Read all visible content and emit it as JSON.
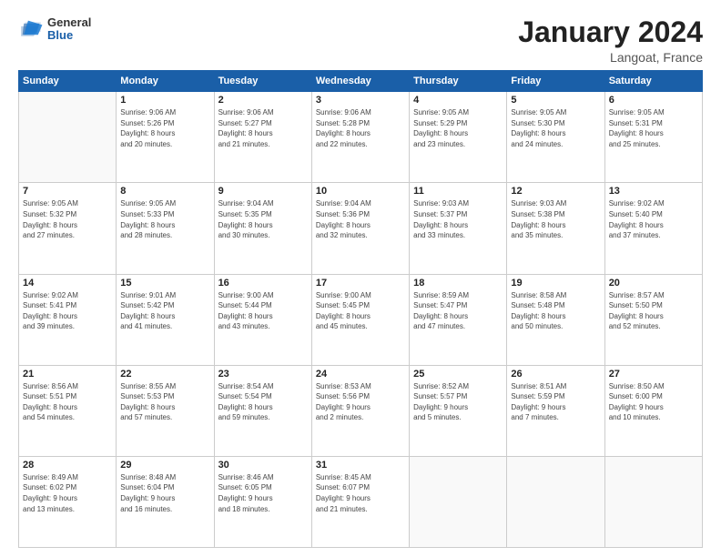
{
  "logo": {
    "general": "General",
    "blue": "Blue"
  },
  "header": {
    "month": "January 2024",
    "location": "Langoat, France"
  },
  "weekdays": [
    "Sunday",
    "Monday",
    "Tuesday",
    "Wednesday",
    "Thursday",
    "Friday",
    "Saturday"
  ],
  "weeks": [
    [
      {
        "day": "",
        "info": ""
      },
      {
        "day": "1",
        "info": "Sunrise: 9:06 AM\nSunset: 5:26 PM\nDaylight: 8 hours\nand 20 minutes."
      },
      {
        "day": "2",
        "info": "Sunrise: 9:06 AM\nSunset: 5:27 PM\nDaylight: 8 hours\nand 21 minutes."
      },
      {
        "day": "3",
        "info": "Sunrise: 9:06 AM\nSunset: 5:28 PM\nDaylight: 8 hours\nand 22 minutes."
      },
      {
        "day": "4",
        "info": "Sunrise: 9:05 AM\nSunset: 5:29 PM\nDaylight: 8 hours\nand 23 minutes."
      },
      {
        "day": "5",
        "info": "Sunrise: 9:05 AM\nSunset: 5:30 PM\nDaylight: 8 hours\nand 24 minutes."
      },
      {
        "day": "6",
        "info": "Sunrise: 9:05 AM\nSunset: 5:31 PM\nDaylight: 8 hours\nand 25 minutes."
      }
    ],
    [
      {
        "day": "7",
        "info": "Sunrise: 9:05 AM\nSunset: 5:32 PM\nDaylight: 8 hours\nand 27 minutes."
      },
      {
        "day": "8",
        "info": "Sunrise: 9:05 AM\nSunset: 5:33 PM\nDaylight: 8 hours\nand 28 minutes."
      },
      {
        "day": "9",
        "info": "Sunrise: 9:04 AM\nSunset: 5:35 PM\nDaylight: 8 hours\nand 30 minutes."
      },
      {
        "day": "10",
        "info": "Sunrise: 9:04 AM\nSunset: 5:36 PM\nDaylight: 8 hours\nand 32 minutes."
      },
      {
        "day": "11",
        "info": "Sunrise: 9:03 AM\nSunset: 5:37 PM\nDaylight: 8 hours\nand 33 minutes."
      },
      {
        "day": "12",
        "info": "Sunrise: 9:03 AM\nSunset: 5:38 PM\nDaylight: 8 hours\nand 35 minutes."
      },
      {
        "day": "13",
        "info": "Sunrise: 9:02 AM\nSunset: 5:40 PM\nDaylight: 8 hours\nand 37 minutes."
      }
    ],
    [
      {
        "day": "14",
        "info": "Sunrise: 9:02 AM\nSunset: 5:41 PM\nDaylight: 8 hours\nand 39 minutes."
      },
      {
        "day": "15",
        "info": "Sunrise: 9:01 AM\nSunset: 5:42 PM\nDaylight: 8 hours\nand 41 minutes."
      },
      {
        "day": "16",
        "info": "Sunrise: 9:00 AM\nSunset: 5:44 PM\nDaylight: 8 hours\nand 43 minutes."
      },
      {
        "day": "17",
        "info": "Sunrise: 9:00 AM\nSunset: 5:45 PM\nDaylight: 8 hours\nand 45 minutes."
      },
      {
        "day": "18",
        "info": "Sunrise: 8:59 AM\nSunset: 5:47 PM\nDaylight: 8 hours\nand 47 minutes."
      },
      {
        "day": "19",
        "info": "Sunrise: 8:58 AM\nSunset: 5:48 PM\nDaylight: 8 hours\nand 50 minutes."
      },
      {
        "day": "20",
        "info": "Sunrise: 8:57 AM\nSunset: 5:50 PM\nDaylight: 8 hours\nand 52 minutes."
      }
    ],
    [
      {
        "day": "21",
        "info": "Sunrise: 8:56 AM\nSunset: 5:51 PM\nDaylight: 8 hours\nand 54 minutes."
      },
      {
        "day": "22",
        "info": "Sunrise: 8:55 AM\nSunset: 5:53 PM\nDaylight: 8 hours\nand 57 minutes."
      },
      {
        "day": "23",
        "info": "Sunrise: 8:54 AM\nSunset: 5:54 PM\nDaylight: 8 hours\nand 59 minutes."
      },
      {
        "day": "24",
        "info": "Sunrise: 8:53 AM\nSunset: 5:56 PM\nDaylight: 9 hours\nand 2 minutes."
      },
      {
        "day": "25",
        "info": "Sunrise: 8:52 AM\nSunset: 5:57 PM\nDaylight: 9 hours\nand 5 minutes."
      },
      {
        "day": "26",
        "info": "Sunrise: 8:51 AM\nSunset: 5:59 PM\nDaylight: 9 hours\nand 7 minutes."
      },
      {
        "day": "27",
        "info": "Sunrise: 8:50 AM\nSunset: 6:00 PM\nDaylight: 9 hours\nand 10 minutes."
      }
    ],
    [
      {
        "day": "28",
        "info": "Sunrise: 8:49 AM\nSunset: 6:02 PM\nDaylight: 9 hours\nand 13 minutes."
      },
      {
        "day": "29",
        "info": "Sunrise: 8:48 AM\nSunset: 6:04 PM\nDaylight: 9 hours\nand 16 minutes."
      },
      {
        "day": "30",
        "info": "Sunrise: 8:46 AM\nSunset: 6:05 PM\nDaylight: 9 hours\nand 18 minutes."
      },
      {
        "day": "31",
        "info": "Sunrise: 8:45 AM\nSunset: 6:07 PM\nDaylight: 9 hours\nand 21 minutes."
      },
      {
        "day": "",
        "info": ""
      },
      {
        "day": "",
        "info": ""
      },
      {
        "day": "",
        "info": ""
      }
    ]
  ]
}
